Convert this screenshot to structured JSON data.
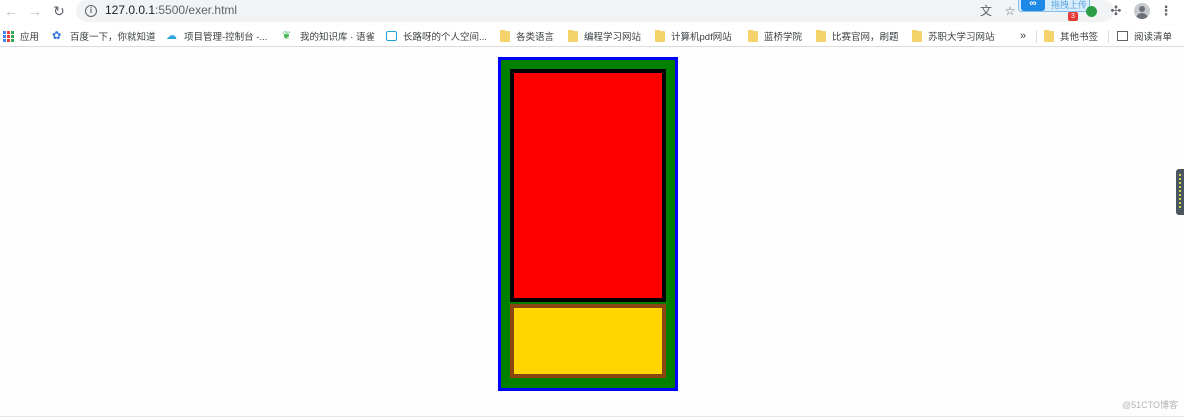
{
  "browser": {
    "url_host": "127.0.0.1",
    "url_path": ":5500/exer.html",
    "extension_popup_label": "拖拽上传",
    "extension_count": "3"
  },
  "bookmarks": [
    {
      "label": "应用",
      "icon": "apps-grid-icon"
    },
    {
      "label": "百度一下，你就知道",
      "icon": "baidu-paw-icon"
    },
    {
      "label": "项目管理-控制台 -...",
      "icon": "cloud-icon"
    },
    {
      "label": "我的知识库 · 语雀",
      "icon": "yuque-leaf-icon"
    },
    {
      "label": "长路呀的个人空间...",
      "icon": "bilibili-tv-icon"
    },
    {
      "label": "各类语言",
      "icon": "folder-icon"
    },
    {
      "label": "编程学习网站",
      "icon": "folder-icon"
    },
    {
      "label": "计算机pdf网站",
      "icon": "folder-icon"
    },
    {
      "label": "蓝桥学院",
      "icon": "folder-icon"
    },
    {
      "label": "比赛官网，刷题",
      "icon": "folder-icon"
    },
    {
      "label": "苏职大学习网站",
      "icon": "folder-icon"
    }
  ],
  "bookmarks_overflow": "»",
  "other_bookmarks": "其他书签",
  "reading_list": "阅读清单",
  "page": {
    "outer_color": "#008000",
    "outer_border": "#0000ff",
    "top_box_color": "#ff0000",
    "top_box_border": "#000000",
    "bottom_box_color": "#ffd700",
    "bottom_box_border": "#8b4513"
  },
  "watermark": "@51CTO博客"
}
